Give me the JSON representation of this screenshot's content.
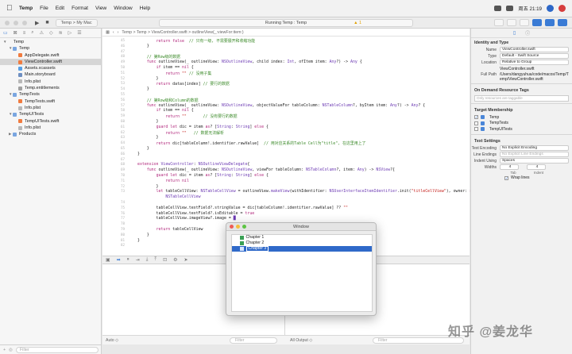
{
  "menubar": {
    "apple_icon": "apple-logo-icon",
    "app_name": "Temp",
    "items": [
      "File",
      "Edit",
      "Format",
      "View",
      "Window",
      "Help"
    ],
    "clock": "周五 21:19"
  },
  "toolbar": {
    "scheme": "Temp > My Mac",
    "status": "Running Temp : Temp",
    "warnings": "1"
  },
  "navigator": {
    "filter_placeholder": "Filter",
    "items": [
      {
        "label": "Temp",
        "depth": 0,
        "icon": "project",
        "arrow": "▼",
        "selected": false
      },
      {
        "label": "Temp",
        "depth": 1,
        "icon": "folder",
        "arrow": "▼",
        "selected": false
      },
      {
        "label": "AppDelegate.swift",
        "depth": 2,
        "icon": "swift",
        "arrow": "",
        "selected": false
      },
      {
        "label": "ViewController.swift",
        "depth": 2,
        "icon": "swift",
        "arrow": "",
        "selected": true
      },
      {
        "label": "Assets.xcassets",
        "depth": 2,
        "icon": "asset",
        "arrow": "",
        "selected": false
      },
      {
        "label": "Main.storyboard",
        "depth": 2,
        "icon": "board",
        "arrow": "",
        "selected": false
      },
      {
        "label": "Info.plist",
        "depth": 2,
        "icon": "plist",
        "arrow": "",
        "selected": false
      },
      {
        "label": "Temp.entitlements",
        "depth": 2,
        "icon": "ent",
        "arrow": "",
        "selected": false
      },
      {
        "label": "TempTests",
        "depth": 1,
        "icon": "folder",
        "arrow": "▼",
        "selected": false
      },
      {
        "label": "TempTests.swift",
        "depth": 2,
        "icon": "swift",
        "arrow": "",
        "selected": false
      },
      {
        "label": "Info.plist",
        "depth": 2,
        "icon": "plist",
        "arrow": "",
        "selected": false
      },
      {
        "label": "TempUITests",
        "depth": 1,
        "icon": "folder",
        "arrow": "▼",
        "selected": false
      },
      {
        "label": "TempUITests.swift",
        "depth": 2,
        "icon": "swift",
        "arrow": "",
        "selected": false
      },
      {
        "label": "Info.plist",
        "depth": 2,
        "icon": "plist",
        "arrow": "",
        "selected": false
      },
      {
        "label": "Products",
        "depth": 1,
        "icon": "folder",
        "arrow": "▶",
        "selected": false
      }
    ]
  },
  "editor": {
    "breadcrumb": "Temp > Temp > ViewController.swift > outlineView(_:viewFor:item:)",
    "lines": [
      {
        "n": "45",
        "html": "        <span class='kw'>return</span> <span class='kw'>false</span>  <span class='cm'>// 只有一级, 不需要展开和收缩功能</span>"
      },
      {
        "n": "46",
        "html": "    }"
      },
      {
        "n": "47",
        "html": ""
      },
      {
        "n": "48",
        "html": "    <span class='cm'>// 第Row级的数据</span>"
      },
      {
        "n": "49",
        "html": "    <span class='kw'>func</span> outlineView(_ outlineView: <span class='ty'>NSOutlineView</span>, child index: <span class='ty'>Int</span>, ofItem item: <span class='ty'>Any</span>?) -> <span class='ty'>Any</span> {"
      },
      {
        "n": "50",
        "html": "        <span class='kw'>if</span> item == <span class='kw'>nil</span> {"
      },
      {
        "n": "51",
        "html": "            <span class='kw'>return</span> <span class='st'>\"\"</span> <span class='cm'>// 没用子集</span>"
      },
      {
        "n": "52",
        "html": "        }"
      },
      {
        "n": "53",
        "html": "        <span class='kw'>return</span> datas[index] <span class='cm'>// 要行的数据</span>"
      },
      {
        "n": "54",
        "html": "    }"
      },
      {
        "n": "55",
        "html": ""
      },
      {
        "n": "56",
        "html": "    <span class='cm'>// 第Row级和Column的数据</span>"
      },
      {
        "n": "57",
        "html": "    <span class='kw'>func</span> outlineView(_ outlineView: <span class='ty'>NSOutlineView</span>, objectValueFor tableColumn: <span class='ty'>NSTableColumn</span>?, byItem item: <span class='ty'>Any</span>?) -> <span class='ty'>Any</span>? {"
      },
      {
        "n": "58",
        "html": "        <span class='kw'>if</span> item == <span class='kw'>nil</span> {"
      },
      {
        "n": "59",
        "html": "            <span class='kw'>return</span> <span class='st'>\"\"</span>       <span class='cm'>// 没有要行的数据</span>"
      },
      {
        "n": "60",
        "html": "        }"
      },
      {
        "n": "61",
        "html": "        <span class='kw'>guard</span> <span class='kw'>let</span> dic = item <span class='kw'>as</span>? [<span class='ty'>String</span>: <span class='ty'>String</span>] <span class='kw'>else</span> {"
      },
      {
        "n": "62",
        "html": "            <span class='kw'>return</span> <span class='st'>\"\"</span>   <span class='cm'>// 数据无法解析</span>"
      },
      {
        "n": "63",
        "html": "        }"
      },
      {
        "n": "64",
        "html": "        <span class='kw'>return</span> dic[tableColumn!.identifier.rawValue]  <span class='cm'>// 用对应关系的Table Cell为\"title\", 在这里用上了</span>"
      },
      {
        "n": "65",
        "html": "    }"
      },
      {
        "n": "66",
        "html": "}"
      },
      {
        "n": "67",
        "html": ""
      },
      {
        "n": "68",
        "html": "<span class='kw'>extension</span> <span class='ty'>ViewController</span>: <span class='ty'>NSOutlineViewDelegate</span>{"
      },
      {
        "n": "69",
        "html": "    <span class='kw'>func</span> outlineView(_ outlineView: <span class='ty'>NSOutlineView</span>, viewFor tableColumn: <span class='ty'>NSTableColumn</span>?, item: <span class='ty'>Any</span>) -> <span class='ty'>NSView</span>?{"
      },
      {
        "n": "70",
        "html": "        <span class='kw'>guard</span> <span class='kw'>let</span> dic = item <span class='kw'>as</span>? [<span class='ty'>String</span>: <span class='ty'>String</span>] <span class='kw'>else</span> {"
      },
      {
        "n": "71",
        "html": "            <span class='kw'>return</span> <span class='kw'>nil</span>"
      },
      {
        "n": "72",
        "html": "        }"
      },
      {
        "n": "73",
        "html": "        <span class='kw'>let</span> tableCellView: <span class='ty'>NSTableCellView</span> = outlineView.<span class='ty'>makeView</span>(withIdentifier: <span class='ty'>NSUserInterfaceItemIdentifier</span>.init(<span class='st'>\"titleCellView\"</span>), owner: <span class='kw'>self</span>)! <span class='kw'>as</span>!"
      },
      {
        "n": "",
        "html": "            <span class='ty'>NSTableCellView</span>"
      },
      {
        "n": "74",
        "html": ""
      },
      {
        "n": "75",
        "html": "        tableCellView.textField?.stringValue = dic[tableColumn!.identifier.rawValue] ?? <span class='st'>\"\"</span>"
      },
      {
        "n": "76",
        "html": "        tableCellView.textField?.isEditable = <span class='kw'>true</span>"
      },
      {
        "n": "77",
        "html": "        tableCellView.imageView?.image = <span class='ty'>█</span>"
      },
      {
        "n": "78",
        "html": ""
      },
      {
        "n": "79",
        "html": "        <span class='kw'>return</span> tableCellView"
      },
      {
        "n": "80",
        "html": "    }"
      },
      {
        "n": "81",
        "html": "}"
      },
      {
        "n": "82",
        "html": ""
      }
    ]
  },
  "console": {
    "auto_label": "Auto ◇",
    "filter_placeholder": "Filter",
    "all_output": "All Output ◇",
    "filter2_placeholder": "Filter"
  },
  "inspector": {
    "identity_header": "Identity and Type",
    "name_label": "Name",
    "name_value": "ViewController.swift",
    "type_label": "Type",
    "type_value": "Default - Swift Source",
    "location_label": "Location",
    "location_value": "Relative to Group",
    "location_file": "ViewController.swift",
    "fullpath_label": "Full Path",
    "fullpath_value": "/Users/dangyuhua/code/macos/Temp/Temp/ViewController.swift",
    "odr_header": "On Demand Resource Tags",
    "odr_placeholder": "Only resources are taggable",
    "target_header": "Target Membership",
    "targets": [
      {
        "label": "Temp",
        "checked": true
      },
      {
        "label": "TempTests",
        "checked": false
      },
      {
        "label": "TempUITests",
        "checked": false
      }
    ],
    "text_header": "Text Settings",
    "encoding_label": "Text Encoding",
    "encoding_value": "No Explicit Encoding",
    "endings_label": "Line Endings",
    "endings_value": "No Explicit Line Endings",
    "indent_label": "Indent Using",
    "indent_value": "Spaces",
    "widths_label": "Widths",
    "tab_value": "4",
    "indent_value_num": "4",
    "tab_label": "Tab",
    "indentw_label": "Indent",
    "wrap_label": "Wrap lines"
  },
  "app_window": {
    "title": "Window",
    "rows": [
      "Chapter 1",
      "Chapter 2",
      "Chapter 3"
    ],
    "selected_index": 2
  },
  "watermark": "知乎 @姜龙华",
  "colors": {
    "accent": "#2f69c9",
    "keyword": "#b0247a",
    "comment": "#3b8a29",
    "type": "#6c3ab3",
    "string": "#c41a16"
  }
}
